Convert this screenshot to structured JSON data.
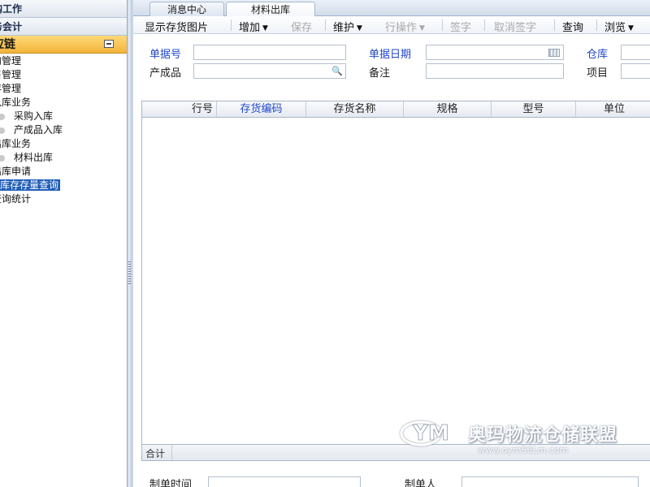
{
  "nav": {
    "headers": [
      "购工作",
      "务会计"
    ],
    "active_section": "应链",
    "items": [
      {
        "label": "购管理",
        "level": 1
      },
      {
        "label": "售管理",
        "level": 1
      },
      {
        "label": "存管理",
        "level": 1
      },
      {
        "label": "入库业务",
        "level": 1
      },
      {
        "label": "采购入库",
        "level": 2
      },
      {
        "label": "产成品入库",
        "level": 2
      },
      {
        "label": "出库业务",
        "level": 1
      },
      {
        "label": "材料出库",
        "level": 2
      },
      {
        "label": "出库申请",
        "level": 1
      },
      {
        "label": "库存存量查询",
        "level": 1,
        "selected": true
      },
      {
        "label": "查询统计",
        "level": 1
      }
    ]
  },
  "tabs": [
    "消息中心",
    "材料出库"
  ],
  "active_tab": "材料出库",
  "toolbar": {
    "show_image": "显示存货图片",
    "add": "增加",
    "save": "保存",
    "maintain": "维护",
    "row_ops": "行操作",
    "sign": "签字",
    "cancel_sign": "取消签字",
    "query": "查询",
    "browse": "浏览"
  },
  "form": {
    "doc_no_label": "单据号",
    "doc_date_label": "单据日期",
    "warehouse_label": "仓库",
    "product_label": "产成品",
    "remark_label": "备注",
    "project_label": "项目"
  },
  "grid": {
    "columns": [
      "行号",
      "存货编码",
      "存货名称",
      "规格",
      "型号",
      "单位"
    ],
    "highlighted_column": "存货编码",
    "rows": [],
    "footer_label": "合计"
  },
  "bottom": {
    "created_time_label": "制单时间",
    "creator_label": "制单人"
  },
  "watermark": {
    "name": "奥玛物流仓储联盟",
    "url": "www.oym56Lm.com"
  },
  "colors": {
    "accent_blue": "#2046c9",
    "selected_bg": "#1f5eb8",
    "active_section_bg": "#f2b43c"
  }
}
